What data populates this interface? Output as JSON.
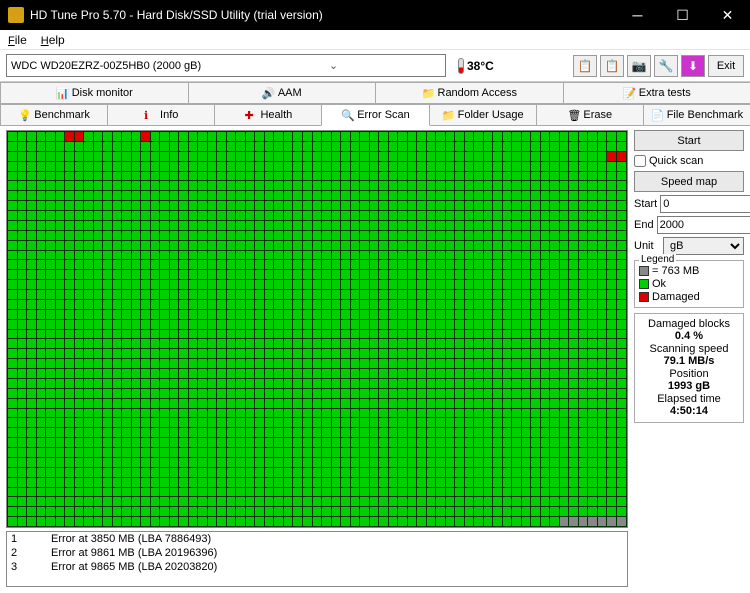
{
  "title": "HD Tune Pro 5.70 - Hard Disk/SSD Utility (trial version)",
  "menu": {
    "file": "File",
    "help": "Help"
  },
  "drive": "WDC WD20EZRZ-00Z5HB0 (2000 gB)",
  "temp": "38°C",
  "exit": "Exit",
  "tabs": {
    "top": [
      "Disk monitor",
      "AAM",
      "Random Access",
      "Extra tests"
    ],
    "bottom": [
      "Benchmark",
      "Info",
      "Health",
      "Error Scan",
      "Folder Usage",
      "Erase",
      "File Benchmark"
    ]
  },
  "sidebar": {
    "start": "Start",
    "quickscan": "Quick scan",
    "speedmap": "Speed map",
    "start_lbl": "Start",
    "start_val": "0",
    "end_lbl": "End",
    "end_val": "2000",
    "unit_lbl": "Unit",
    "unit_val": "gB",
    "legend_title": "Legend",
    "legend_block": "= 763 MB",
    "legend_ok": "Ok",
    "legend_dmg": "Damaged",
    "stats": {
      "dmg_lbl": "Damaged blocks",
      "dmg_val": "0.4 %",
      "spd_lbl": "Scanning speed",
      "spd_val": "79.1 MB/s",
      "pos_lbl": "Position",
      "pos_val": "1993 gB",
      "elapsed_lbl": "Elapsed time",
      "elapsed_val": "4:50:14"
    }
  },
  "errors": [
    {
      "n": "1",
      "msg": "Error at 3850 MB (LBA 7886493)"
    },
    {
      "n": "2",
      "msg": "Error at 9861 MB (LBA 20196396)"
    },
    {
      "n": "3",
      "msg": "Error at 9865 MB (LBA 20203820)"
    }
  ],
  "grid": {
    "cols": 65,
    "rows": 40,
    "damaged": [
      [
        0,
        6
      ],
      [
        0,
        7
      ],
      [
        0,
        14
      ],
      [
        2,
        63
      ],
      [
        2,
        64
      ]
    ],
    "grey": [
      [
        39,
        58
      ],
      [
        39,
        59
      ],
      [
        39,
        60
      ],
      [
        39,
        61
      ],
      [
        39,
        62
      ],
      [
        39,
        63
      ],
      [
        39,
        64
      ]
    ]
  }
}
